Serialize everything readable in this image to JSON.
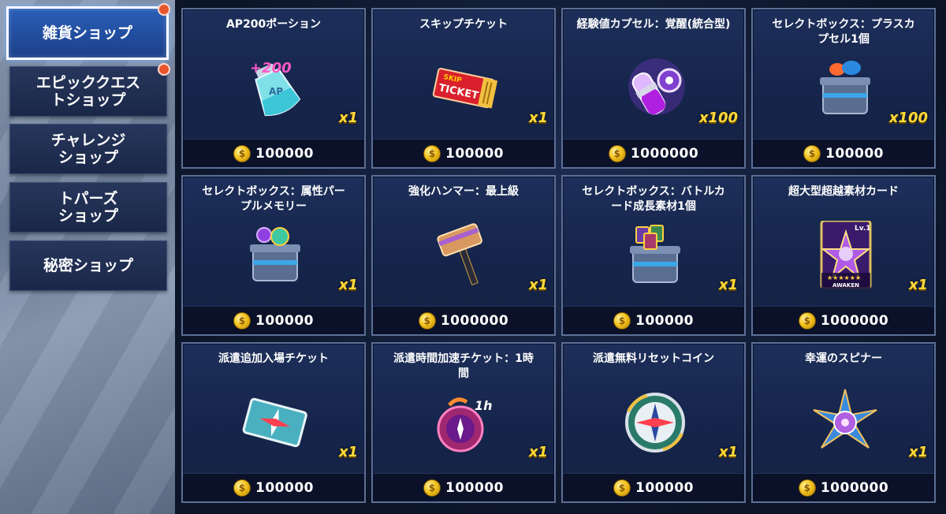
{
  "sidebar": {
    "tabs": [
      {
        "label": "雑貨ショップ",
        "active": true,
        "badge": true
      },
      {
        "label": "エピッククエス\nトショップ",
        "active": false,
        "badge": true
      },
      {
        "label": "チャレンジ\nショップ",
        "active": false,
        "badge": false
      },
      {
        "label": "トパーズ\nショップ",
        "active": false,
        "badge": false
      },
      {
        "label": "秘密ショップ",
        "active": false,
        "badge": false
      }
    ]
  },
  "currency_icon": "gold-coin-icon",
  "items": [
    {
      "name": "AP200ポーション",
      "quantity": "x1",
      "price": "100000",
      "icon": "ap-potion-icon"
    },
    {
      "name": "スキップチケット",
      "quantity": "x1",
      "price": "100000",
      "icon": "skip-ticket-icon"
    },
    {
      "name": "経験値カプセル：覚醒(統合型)",
      "quantity": "x100",
      "price": "1000000",
      "icon": "exp-capsule-icon"
    },
    {
      "name": "セレクトボックス：プラスカ\nプセル1個",
      "quantity": "x100",
      "price": "100000",
      "icon": "select-box-icon"
    },
    {
      "name": "セレクトボックス：属性パー\nプルメモリー",
      "quantity": "x1",
      "price": "100000",
      "icon": "select-box-icon"
    },
    {
      "name": "強化ハンマー：最上級",
      "quantity": "x1",
      "price": "1000000",
      "icon": "hammer-icon"
    },
    {
      "name": "セレクトボックス：バトルカ\nード成長素材1個",
      "quantity": "x1",
      "price": "100000",
      "icon": "select-box-icon"
    },
    {
      "name": "超大型超越素材カード",
      "quantity": "x1",
      "price": "1000000",
      "icon": "awaken-card-icon"
    },
    {
      "name": "派遣追加入場チケット",
      "quantity": "x1",
      "price": "100000",
      "icon": "dispatch-ticket-icon"
    },
    {
      "name": "派遣時間加速チケット：1時\n間",
      "quantity": "x1",
      "price": "100000",
      "icon": "speedup-ticket-icon"
    },
    {
      "name": "派遣無料リセットコイン",
      "quantity": "x1",
      "price": "100000",
      "icon": "reset-coin-icon"
    },
    {
      "name": "幸運のスピナー",
      "quantity": "x1",
      "price": "1000000",
      "icon": "lucky-spinner-icon"
    }
  ],
  "art_text": {
    "ap_label": "+200",
    "ap_sub": "AP",
    "ticket_top": "SKIP",
    "ticket_main": "TICKET",
    "card_level": "Lv.1",
    "card_stars": "★★★★★★",
    "card_caption": "AWAKEN",
    "speed_label": "1h"
  },
  "colors": {
    "quantity": "#ffd93a",
    "active_tab": "#2a5fb8",
    "badge": "#e8542c"
  }
}
